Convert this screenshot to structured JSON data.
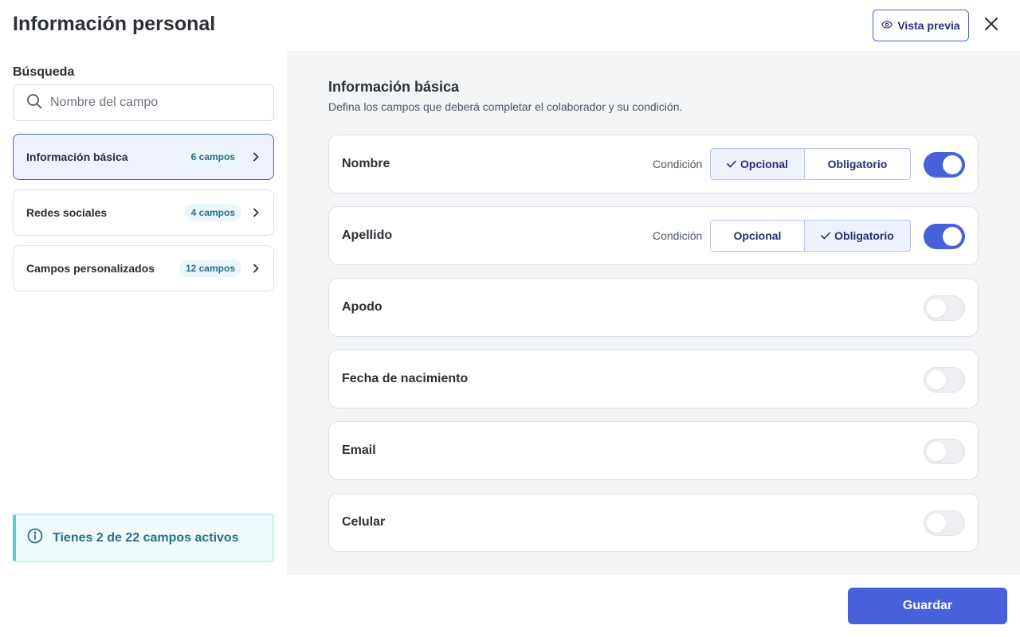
{
  "header": {
    "title": "Información personal",
    "preview_label": "Vista previa"
  },
  "sidebar": {
    "search_label": "Búsqueda",
    "search_placeholder": "Nombre del campo",
    "items": [
      {
        "label": "Información básica",
        "badge": "6 campos",
        "active": true
      },
      {
        "label": "Redes sociales",
        "badge": "4 campos",
        "active": false
      },
      {
        "label": "Campos personalizados",
        "badge": "12 campos",
        "active": false
      }
    ],
    "info_text": "Tienes 2 de 22 campos activos"
  },
  "main": {
    "section_title": "Información básica",
    "section_desc": "Defina los campos que deberá completar el colaborador y su condición.",
    "condition_label": "Condición",
    "option_optional": "Opcional",
    "option_required": "Obligatorio",
    "fields": [
      {
        "name": "Nombre",
        "enabled": true,
        "condition": "Opcional"
      },
      {
        "name": "Apellido",
        "enabled": true,
        "condition": "Obligatorio"
      },
      {
        "name": "Apodo",
        "enabled": false
      },
      {
        "name": "Fecha de nacimiento",
        "enabled": false
      },
      {
        "name": "Email",
        "enabled": false
      },
      {
        "name": "Celular",
        "enabled": false
      }
    ]
  },
  "footer": {
    "save_label": "Guardar"
  },
  "colors": {
    "accent": "#4661db",
    "info": "#2a6f83"
  }
}
